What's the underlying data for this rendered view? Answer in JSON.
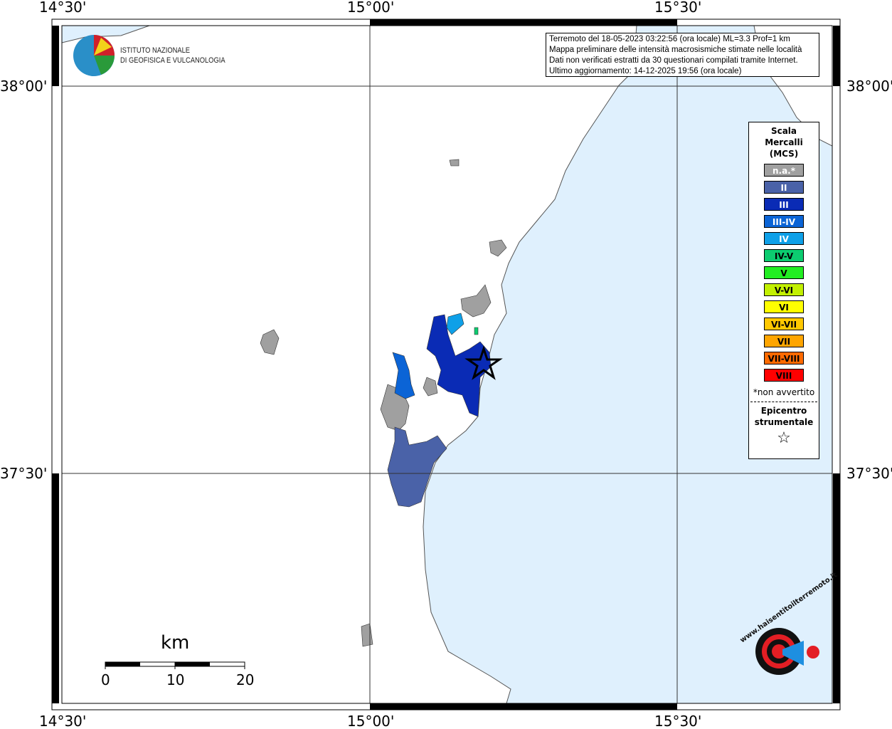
{
  "axes": {
    "lon_labels": [
      "14°30'",
      "15°00'",
      "15°30'"
    ],
    "lat_labels": [
      "38°00'",
      "37°30'"
    ]
  },
  "info": {
    "lines": [
      "Terremoto del 18-05-2023 03:22:56 (ora locale) ML=3.3 Prof=1 km",
      "Mappa preliminare delle intensità macrosismiche stimate nelle località",
      "Dati non verificati estratti da 30 questionari compilati tramite Internet.",
      "Ultimo aggiornamento: 14-12-2025 19:56 (ora locale)"
    ]
  },
  "logo": {
    "line1": "ISTITUTO NAZIONALE",
    "line2": "DI GEOFISICA E VULCANOLOGIA"
  },
  "legend": {
    "title": [
      "Scala",
      "Mercalli",
      "(MCS)"
    ],
    "items": [
      {
        "label": "n.a.*",
        "color": "#a0a0a0",
        "text": "#fff"
      },
      {
        "label": "II",
        "color": "#4a62a8",
        "text": "#fff"
      },
      {
        "label": "III",
        "color": "#0a2bb5",
        "text": "#fff"
      },
      {
        "label": "III-IV",
        "color": "#0b64d6",
        "text": "#fff"
      },
      {
        "label": "IV",
        "color": "#0ea0e8",
        "text": "#fff"
      },
      {
        "label": "IV-V",
        "color": "#0ccc70",
        "text": "#000"
      },
      {
        "label": "V",
        "color": "#22ee22",
        "text": "#000"
      },
      {
        "label": "V-VI",
        "color": "#c2f000",
        "text": "#000"
      },
      {
        "label": "VI",
        "color": "#ffff00",
        "text": "#000"
      },
      {
        "label": "VI-VII",
        "color": "#ffc800",
        "text": "#000"
      },
      {
        "label": "VII",
        "color": "#ffa500",
        "text": "#000"
      },
      {
        "label": "VII-VIII",
        "color": "#ff6a00",
        "text": "#000"
      },
      {
        "label": "VIII",
        "color": "#ff0000",
        "text": "#000"
      }
    ],
    "note": "*non avvertito",
    "epicentre": [
      "Epicentro",
      "strumentale"
    ]
  },
  "scale": {
    "unit": "km",
    "ticks": [
      "0",
      "10",
      "20"
    ]
  },
  "brand": {
    "text": "www.haisentitoilterremoto.it"
  },
  "colors": {
    "sea": "#dff0fd",
    "land": "#ffffff"
  }
}
